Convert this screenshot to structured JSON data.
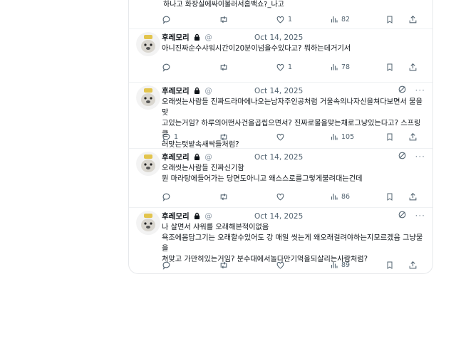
{
  "top_fragment": {
    "text": "하나고 화장실에싸이불러서홈백쇼?_나고",
    "likes": "1",
    "views": "82"
  },
  "tweets": [
    {
      "name": "후레모리",
      "date": "Oct 14, 2025",
      "lines": [
        "아니진짜순수샤워시간이20분이넘을수있다고? 뭐하는데거기서"
      ],
      "replies": "",
      "likes": "1",
      "views": "78"
    },
    {
      "name": "후레모리",
      "date": "Oct 14, 2025",
      "lines": [
        "오래씻는사람들 진짜드라마에나오는남자주인공처럼 거울속의나자신을쳐다보면서 물을맞",
        "고있는거임? 하루의어떤사건을곱씹으면서? 진짜로물을맞는채로그냥있는다고? 스프링클",
        "러맞는텃밭속새싹들처럼?"
      ],
      "replies": "1",
      "likes": "",
      "views": "105"
    },
    {
      "name": "후레모리",
      "date": "Oct 14, 2025",
      "lines": [
        "오래씻는사람들 진짜신기함",
        "뭔 마라탕에들어가는 당면도아니고 왜스스로를그렇게불려대는건데"
      ],
      "replies": "",
      "likes": "",
      "views": "86"
    },
    {
      "name": "후레모리",
      "date": "Oct 14, 2025",
      "lines": [
        "나 살면서 샤워를 오래해본적이없음",
        "욕조에몸담그기는 오래할수있어도 강 매일 씻는게 왜오래걸려야하는지모르겠음 그냥물을",
        "쳐맞고 가만히있는거임? 분수대에서놀다만기억을되살리는사람처럼?"
      ],
      "replies": "",
      "likes": "",
      "views": "89"
    }
  ],
  "icons": {
    "reply": "reply-icon",
    "retweet": "retweet-icon",
    "like": "heart-icon",
    "views": "views-icon",
    "bookmark": "bookmark-icon",
    "share": "share-icon",
    "lock": "lock-icon",
    "grok": "grok-icon",
    "more": "more-icon"
  },
  "colors": {
    "secondary_text": "#536471",
    "divider": "#eff1f3"
  }
}
